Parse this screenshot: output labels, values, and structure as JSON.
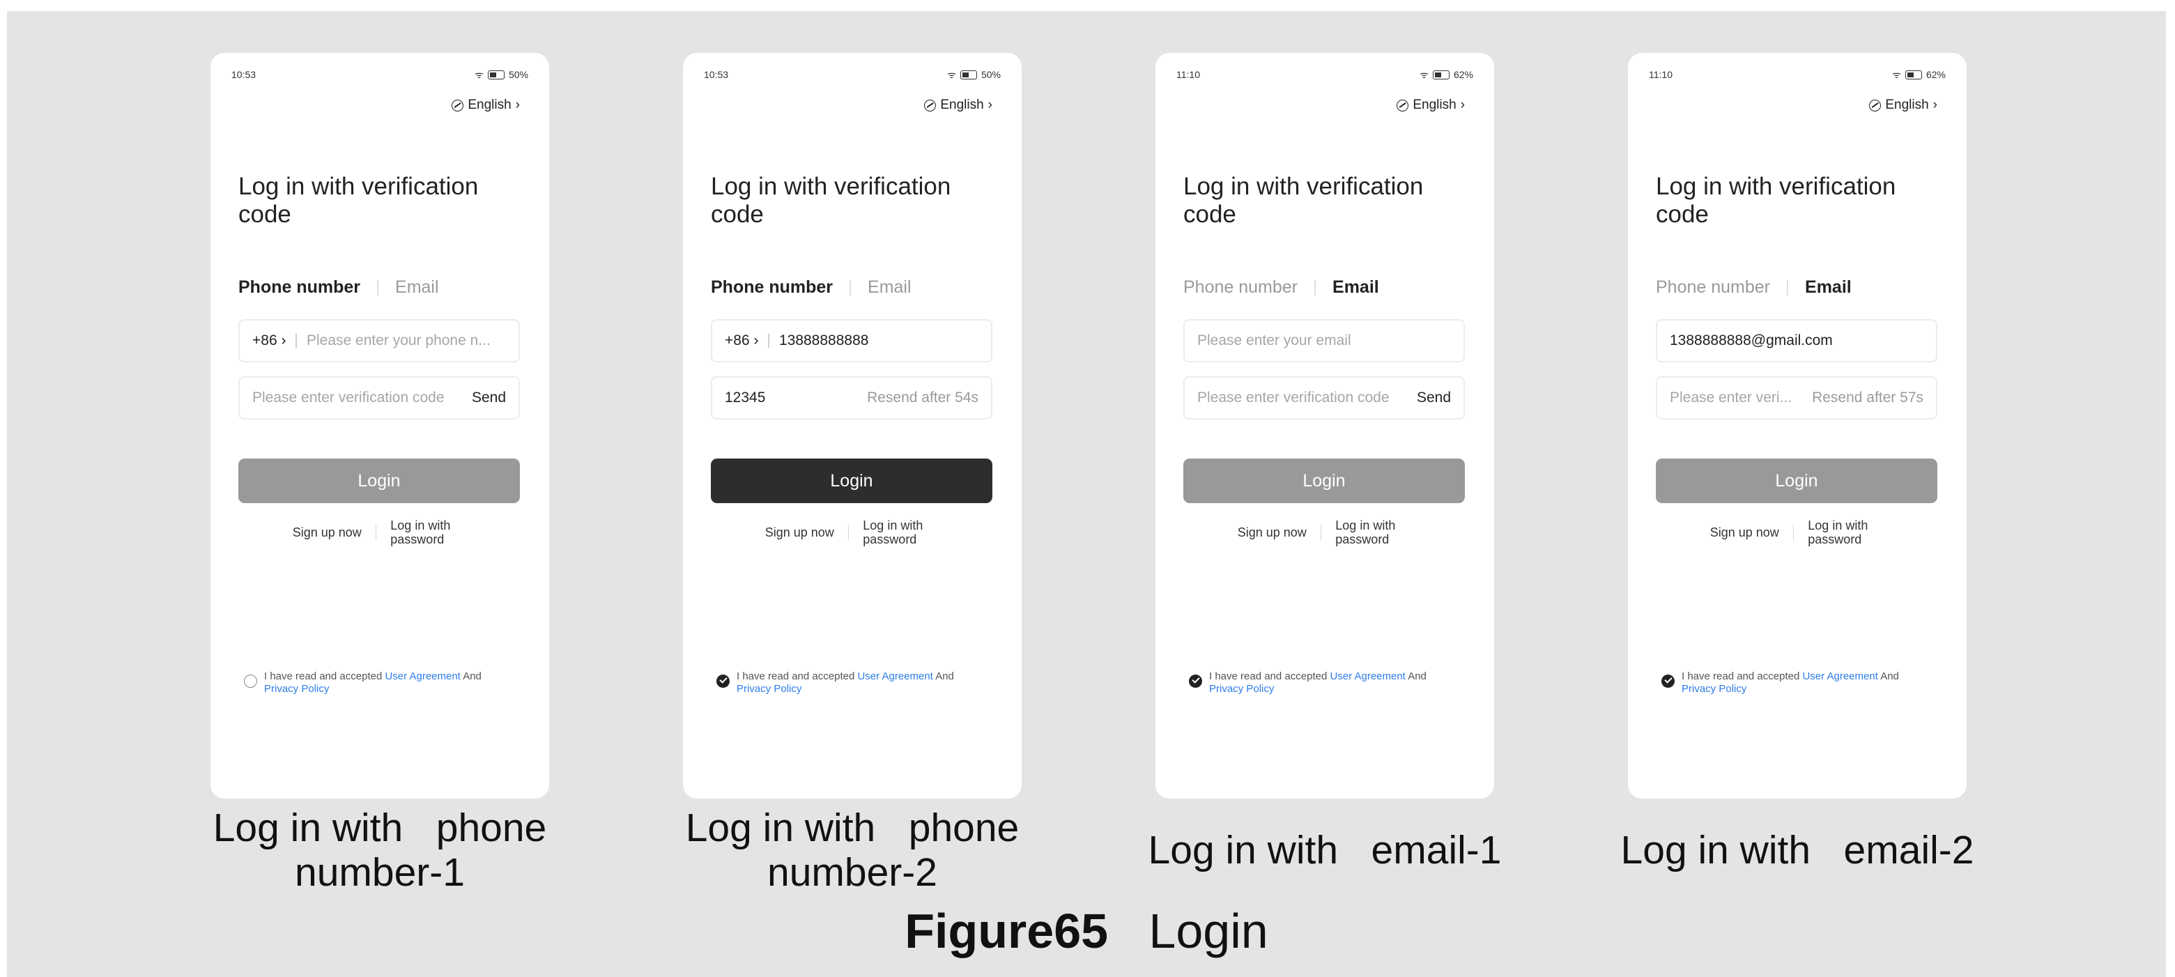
{
  "figure": {
    "number": "Figure65",
    "title": "Login"
  },
  "screens": [
    {
      "caption": "Log in with   phone number-1",
      "time": "10:53",
      "battery": "50%",
      "language": "English",
      "title": "Log in with verification code",
      "tab_phone": "Phone number",
      "tab_email": "Email",
      "active_tab": "phone",
      "country_code": "+86",
      "field1_placeholder": "Please enter your phone n...",
      "field1_value": "",
      "field2_placeholder": "Please enter verification code",
      "field2_value": "",
      "field2_action": "Send",
      "action_type": "send",
      "login_label": "Login",
      "login_active": false,
      "signup": "Sign up now",
      "login_password": "Log in with password",
      "agree_prefix": "I have read and accepted ",
      "user_agreement": "User Agreement",
      "and": " And ",
      "privacy_policy": "Privacy Policy",
      "checked": false
    },
    {
      "caption": "Log in with   phone number-2",
      "time": "10:53",
      "battery": "50%",
      "language": "English",
      "title": "Log in with verification code",
      "tab_phone": "Phone number",
      "tab_email": "Email",
      "active_tab": "phone",
      "country_code": "+86",
      "field1_placeholder": "",
      "field1_value": "13888888888",
      "field2_placeholder": "",
      "field2_value": "12345",
      "field2_action": "Resend after 54s",
      "action_type": "resend",
      "login_label": "Login",
      "login_active": true,
      "signup": "Sign up now",
      "login_password": "Log in with password",
      "agree_prefix": "I have read and accepted ",
      "user_agreement": "User Agreement",
      "and": " And ",
      "privacy_policy": "Privacy Policy",
      "checked": true
    },
    {
      "caption": "Log in with   email-1",
      "time": "11:10",
      "battery": "62%",
      "language": "English",
      "title": "Log in with verification code",
      "tab_phone": "Phone number",
      "tab_email": "Email",
      "active_tab": "email",
      "country_code": "",
      "field1_placeholder": "Please enter your email",
      "field1_value": "",
      "field2_placeholder": "Please enter verification code",
      "field2_value": "",
      "field2_action": "Send",
      "action_type": "send",
      "login_label": "Login",
      "login_active": false,
      "signup": "Sign up now",
      "login_password": "Log in with password",
      "agree_prefix": "I have read and accepted ",
      "user_agreement": "User Agreement",
      "and": " And ",
      "privacy_policy": "Privacy Policy",
      "checked": true
    },
    {
      "caption": "Log in with   email-2",
      "time": "11:10",
      "battery": "62%",
      "language": "English",
      "title": "Log in with verification code",
      "tab_phone": "Phone number",
      "tab_email": "Email",
      "active_tab": "email",
      "country_code": "",
      "field1_placeholder": "",
      "field1_value": "1388888888@gmail.com",
      "field2_placeholder": "Please enter veri...",
      "field2_value": "",
      "field2_action": "Resend after 57s",
      "action_type": "resend",
      "login_label": "Login",
      "login_active": false,
      "signup": "Sign up now",
      "login_password": "Log in with password",
      "agree_prefix": "I have read and accepted ",
      "user_agreement": "User Agreement",
      "and": " And ",
      "privacy_policy": "Privacy Policy",
      "checked": true
    }
  ]
}
